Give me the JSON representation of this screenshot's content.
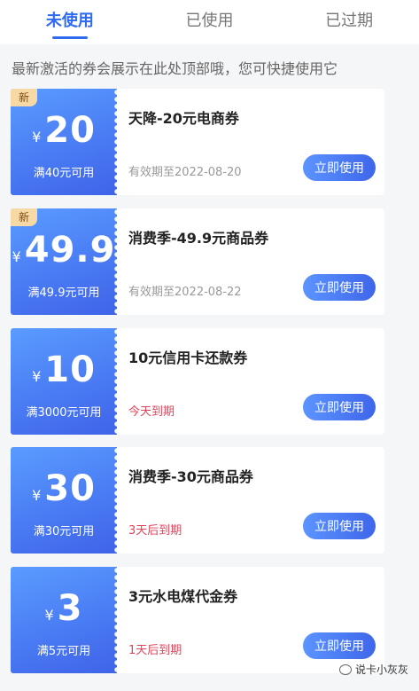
{
  "tabs": [
    {
      "label": "未使用",
      "active": true
    },
    {
      "label": "已使用",
      "active": false
    },
    {
      "label": "已过期",
      "active": false
    }
  ],
  "notice": "最新激活的券会展示在此处顶部哦，您可快捷使用它",
  "currency_symbol": "¥",
  "use_button_label": "立即使用",
  "coupons": [
    {
      "badge": "新",
      "amount": "20",
      "threshold": "满40元可用",
      "title": "天降-20元电商券",
      "expiry": "有效期至2022-08-20",
      "urgent": false
    },
    {
      "badge": "新",
      "amount": "49.9",
      "threshold": "满49.9元可用",
      "title": "消费季-49.9元商品券",
      "expiry": "有效期至2022-08-22",
      "urgent": false
    },
    {
      "badge": "",
      "amount": "10",
      "threshold": "满3000元可用",
      "title": "10元信用卡还款券",
      "expiry": "今天到期",
      "urgent": true
    },
    {
      "badge": "",
      "amount": "30",
      "threshold": "满30元可用",
      "title": "消费季-30元商品券",
      "expiry": "3天后到期",
      "urgent": true
    },
    {
      "badge": "",
      "amount": "3",
      "threshold": "满5元可用",
      "title": "3元水电煤代金券",
      "expiry": "1天后到期",
      "urgent": true
    }
  ],
  "colors": {
    "accent": "#2f6bf0",
    "urgent": "#e0445a",
    "badge_bg": "#f7d9a6"
  },
  "watermark": "说卡小灰灰"
}
